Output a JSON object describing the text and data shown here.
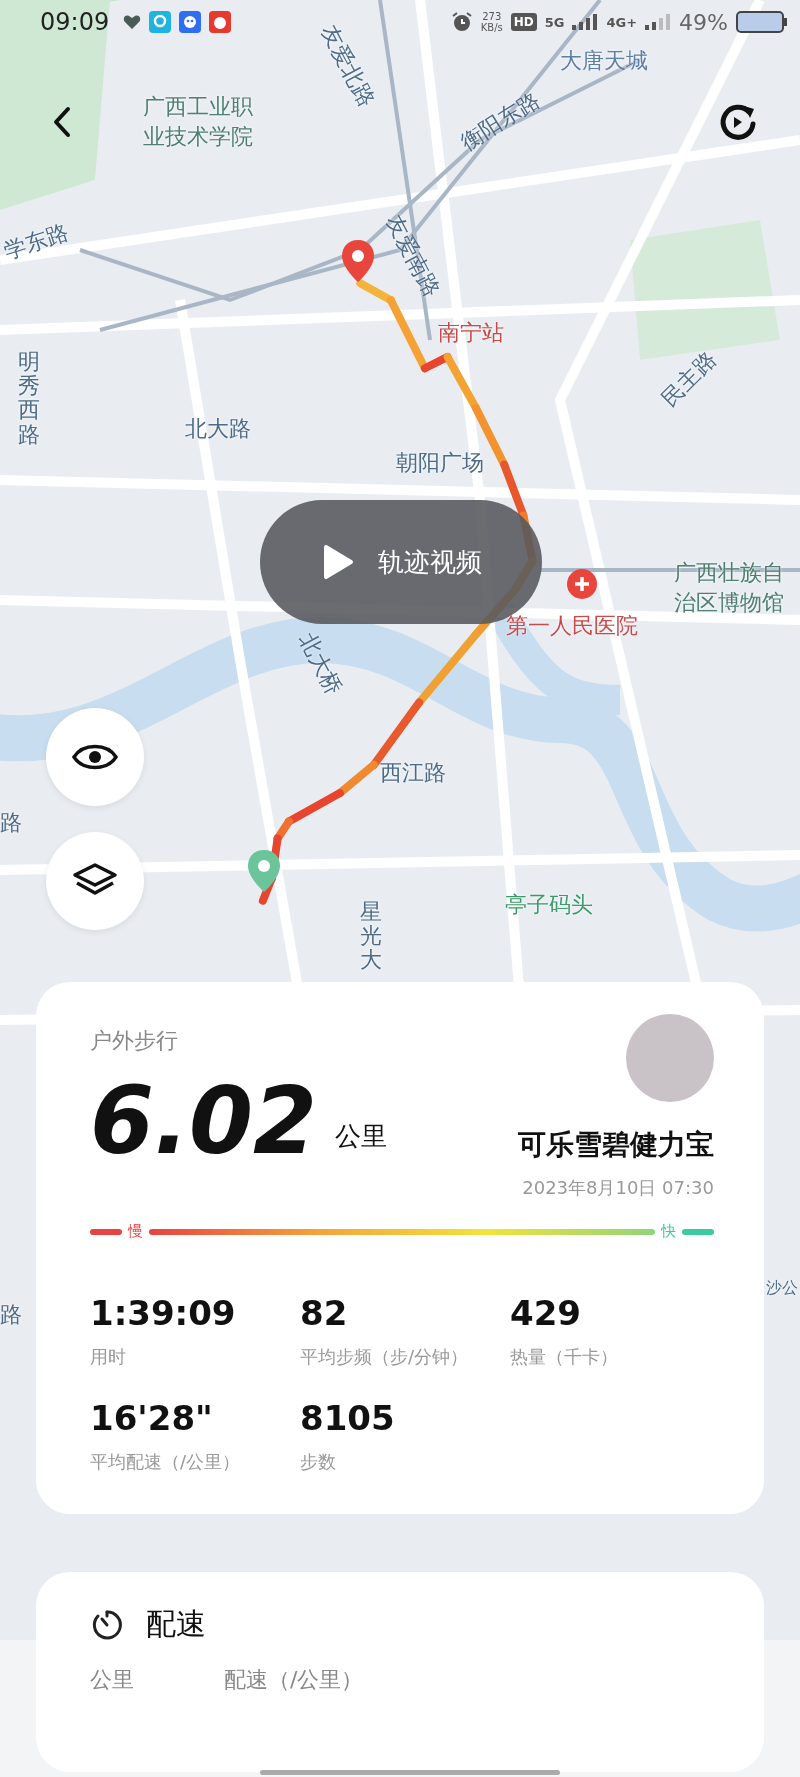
{
  "status_bar": {
    "time": "09:09",
    "network_speed": "273",
    "network_speed_unit": "KB/s",
    "hd": "HD",
    "sim_1": "5G",
    "sim_2": "4G+",
    "battery": "49%"
  },
  "map": {
    "labels": [
      {
        "text": "大唐天城",
        "kind": "place"
      },
      {
        "text": "友爱北路",
        "kind": "road"
      },
      {
        "text": "广西工业职业技术学院",
        "kind": "poi"
      },
      {
        "text": "衡阳东路",
        "kind": "road"
      },
      {
        "text": "友爱南路",
        "kind": "road"
      },
      {
        "text": "学东路",
        "kind": "road"
      },
      {
        "text": "南宁站",
        "kind": "station"
      },
      {
        "text": "明秀西路",
        "kind": "road"
      },
      {
        "text": "北大路",
        "kind": "road"
      },
      {
        "text": "民主路",
        "kind": "road"
      },
      {
        "text": "朝阳广场",
        "kind": "road"
      },
      {
        "text": "广西壮族自治区博物馆",
        "kind": "poi"
      },
      {
        "text": "北大桥",
        "kind": "road"
      },
      {
        "text": "第一人民医院",
        "kind": "station"
      },
      {
        "text": "西江路",
        "kind": "road"
      },
      {
        "text": "亭子码头",
        "kind": "park"
      },
      {
        "text": "星光大",
        "kind": "road"
      },
      {
        "text": "路",
        "kind": "road"
      },
      {
        "text": "路",
        "kind": "road"
      },
      {
        "text": "沙公",
        "kind": "road"
      }
    ],
    "play_button": "轨迹视频"
  },
  "summary": {
    "activity": "户外步行",
    "distance": "6.02",
    "unit": "公里",
    "user": "可乐雪碧健力宝",
    "datetime": "2023年8月10日 07:30",
    "speed_scale": {
      "slow": "慢",
      "fast": "快"
    },
    "stats": [
      {
        "value": "1:39:09",
        "label": "用时"
      },
      {
        "value": "82",
        "label": "平均步频（步/分钟）"
      },
      {
        "value": "429",
        "label": "热量（千卡）"
      },
      {
        "value": "16'28\"",
        "label": "平均配速（/公里）"
      },
      {
        "value": "8105",
        "label": "步数"
      }
    ]
  },
  "pace": {
    "title": "配速",
    "columns": [
      "公里",
      "配速（/公里）"
    ]
  }
}
